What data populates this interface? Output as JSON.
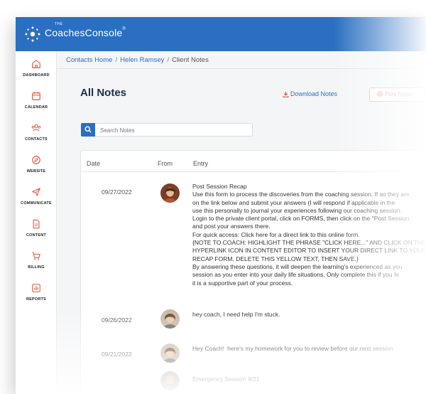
{
  "app": {
    "brand_small": "THE",
    "brand_name": "CoachesConsole",
    "brand_mark": "®"
  },
  "sidebar": {
    "items": [
      {
        "label": "DASHBOARD",
        "icon": "home-icon"
      },
      {
        "label": "CALENDAR",
        "icon": "calendar-icon"
      },
      {
        "label": "CONTACTS",
        "icon": "contacts-icon"
      },
      {
        "label": "WEBSITE",
        "icon": "compass-icon"
      },
      {
        "label": "COMMUNICATE",
        "icon": "send-icon"
      },
      {
        "label": "CONTENT",
        "icon": "document-icon"
      },
      {
        "label": "BILLING",
        "icon": "cart-icon"
      },
      {
        "label": "REPORTS",
        "icon": "chart-icon"
      }
    ]
  },
  "breadcrumb": {
    "home": "Contacts Home",
    "contact": "Helen Ramsey",
    "current": "Client Notes",
    "separator": "/"
  },
  "header": {
    "title": "All Notes",
    "download_label": "Download Notes",
    "print_label": "Print Notes"
  },
  "search": {
    "placeholder": "Search Notes"
  },
  "table": {
    "columns": {
      "date": "Date",
      "from": "From",
      "entry": "Entry"
    },
    "rows": [
      {
        "date": "09/27/2022",
        "entry": "Post Session Recap\nUse this form to process the discoveries from the coaching session. If so they are\non the link below and submit your answers (I will respond if applicable in the\nuse this personally to journal your experiences following our coaching session.\nLogin to the private client portal, click on FORMS, then click on the \"Post Session\nand post your answers there.\nFor quick access: Click here for a direct link to this online form.\n{NOTE TO COACH: HIGHLIGHT THE PHRASE \"CLICK HERE...\" AND CLICK ON THE\nHYPERLINK ICON IN CONTENT EDITOR TO INSERT YOUR DIRECT LINK TO YOUR\nRECAP FORM. DELETE THIS YELLOW TEXT, THEN SAVE.}\nBy answering these questions, it will deepen the learning's experienced as you\nsession as you enter into your daily life situations. Only complete this if you fe\nit is a supportive part of your process."
      },
      {
        "date": "09/26/2022",
        "entry": "hey coach, I need help I'm stuck."
      },
      {
        "date": "09/21/2022",
        "entry": "Hey Coach!  here's my homework for you to review before our next session"
      },
      {
        "date": "",
        "entry": "Emergency Session 9/21"
      }
    ]
  },
  "colors": {
    "brand_blue": "#2a6fc1",
    "title_navy": "#1f2d4a",
    "print_border": "#f3b8a0"
  }
}
